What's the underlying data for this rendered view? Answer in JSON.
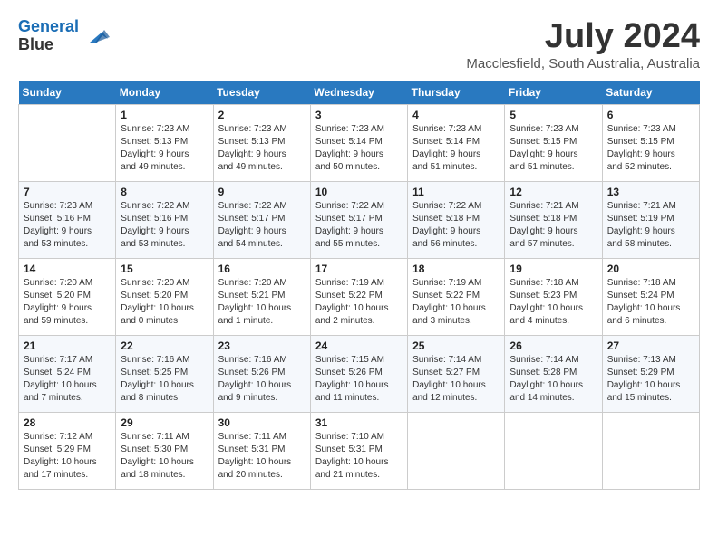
{
  "header": {
    "logo_line1": "General",
    "logo_line2": "Blue",
    "month_title": "July 2024",
    "location": "Macclesfield, South Australia, Australia"
  },
  "days_of_week": [
    "Sunday",
    "Monday",
    "Tuesday",
    "Wednesday",
    "Thursday",
    "Friday",
    "Saturday"
  ],
  "weeks": [
    [
      {
        "day": "",
        "info": ""
      },
      {
        "day": "1",
        "info": "Sunrise: 7:23 AM\nSunset: 5:13 PM\nDaylight: 9 hours\nand 49 minutes."
      },
      {
        "day": "2",
        "info": "Sunrise: 7:23 AM\nSunset: 5:13 PM\nDaylight: 9 hours\nand 49 minutes."
      },
      {
        "day": "3",
        "info": "Sunrise: 7:23 AM\nSunset: 5:14 PM\nDaylight: 9 hours\nand 50 minutes."
      },
      {
        "day": "4",
        "info": "Sunrise: 7:23 AM\nSunset: 5:14 PM\nDaylight: 9 hours\nand 51 minutes."
      },
      {
        "day": "5",
        "info": "Sunrise: 7:23 AM\nSunset: 5:15 PM\nDaylight: 9 hours\nand 51 minutes."
      },
      {
        "day": "6",
        "info": "Sunrise: 7:23 AM\nSunset: 5:15 PM\nDaylight: 9 hours\nand 52 minutes."
      }
    ],
    [
      {
        "day": "7",
        "info": "Sunrise: 7:23 AM\nSunset: 5:16 PM\nDaylight: 9 hours\nand 53 minutes."
      },
      {
        "day": "8",
        "info": "Sunrise: 7:22 AM\nSunset: 5:16 PM\nDaylight: 9 hours\nand 53 minutes."
      },
      {
        "day": "9",
        "info": "Sunrise: 7:22 AM\nSunset: 5:17 PM\nDaylight: 9 hours\nand 54 minutes."
      },
      {
        "day": "10",
        "info": "Sunrise: 7:22 AM\nSunset: 5:17 PM\nDaylight: 9 hours\nand 55 minutes."
      },
      {
        "day": "11",
        "info": "Sunrise: 7:22 AM\nSunset: 5:18 PM\nDaylight: 9 hours\nand 56 minutes."
      },
      {
        "day": "12",
        "info": "Sunrise: 7:21 AM\nSunset: 5:18 PM\nDaylight: 9 hours\nand 57 minutes."
      },
      {
        "day": "13",
        "info": "Sunrise: 7:21 AM\nSunset: 5:19 PM\nDaylight: 9 hours\nand 58 minutes."
      }
    ],
    [
      {
        "day": "14",
        "info": "Sunrise: 7:20 AM\nSunset: 5:20 PM\nDaylight: 9 hours\nand 59 minutes."
      },
      {
        "day": "15",
        "info": "Sunrise: 7:20 AM\nSunset: 5:20 PM\nDaylight: 10 hours\nand 0 minutes."
      },
      {
        "day": "16",
        "info": "Sunrise: 7:20 AM\nSunset: 5:21 PM\nDaylight: 10 hours\nand 1 minute."
      },
      {
        "day": "17",
        "info": "Sunrise: 7:19 AM\nSunset: 5:22 PM\nDaylight: 10 hours\nand 2 minutes."
      },
      {
        "day": "18",
        "info": "Sunrise: 7:19 AM\nSunset: 5:22 PM\nDaylight: 10 hours\nand 3 minutes."
      },
      {
        "day": "19",
        "info": "Sunrise: 7:18 AM\nSunset: 5:23 PM\nDaylight: 10 hours\nand 4 minutes."
      },
      {
        "day": "20",
        "info": "Sunrise: 7:18 AM\nSunset: 5:24 PM\nDaylight: 10 hours\nand 6 minutes."
      }
    ],
    [
      {
        "day": "21",
        "info": "Sunrise: 7:17 AM\nSunset: 5:24 PM\nDaylight: 10 hours\nand 7 minutes."
      },
      {
        "day": "22",
        "info": "Sunrise: 7:16 AM\nSunset: 5:25 PM\nDaylight: 10 hours\nand 8 minutes."
      },
      {
        "day": "23",
        "info": "Sunrise: 7:16 AM\nSunset: 5:26 PM\nDaylight: 10 hours\nand 9 minutes."
      },
      {
        "day": "24",
        "info": "Sunrise: 7:15 AM\nSunset: 5:26 PM\nDaylight: 10 hours\nand 11 minutes."
      },
      {
        "day": "25",
        "info": "Sunrise: 7:14 AM\nSunset: 5:27 PM\nDaylight: 10 hours\nand 12 minutes."
      },
      {
        "day": "26",
        "info": "Sunrise: 7:14 AM\nSunset: 5:28 PM\nDaylight: 10 hours\nand 14 minutes."
      },
      {
        "day": "27",
        "info": "Sunrise: 7:13 AM\nSunset: 5:29 PM\nDaylight: 10 hours\nand 15 minutes."
      }
    ],
    [
      {
        "day": "28",
        "info": "Sunrise: 7:12 AM\nSunset: 5:29 PM\nDaylight: 10 hours\nand 17 minutes."
      },
      {
        "day": "29",
        "info": "Sunrise: 7:11 AM\nSunset: 5:30 PM\nDaylight: 10 hours\nand 18 minutes."
      },
      {
        "day": "30",
        "info": "Sunrise: 7:11 AM\nSunset: 5:31 PM\nDaylight: 10 hours\nand 20 minutes."
      },
      {
        "day": "31",
        "info": "Sunrise: 7:10 AM\nSunset: 5:31 PM\nDaylight: 10 hours\nand 21 minutes."
      },
      {
        "day": "",
        "info": ""
      },
      {
        "day": "",
        "info": ""
      },
      {
        "day": "",
        "info": ""
      }
    ]
  ]
}
